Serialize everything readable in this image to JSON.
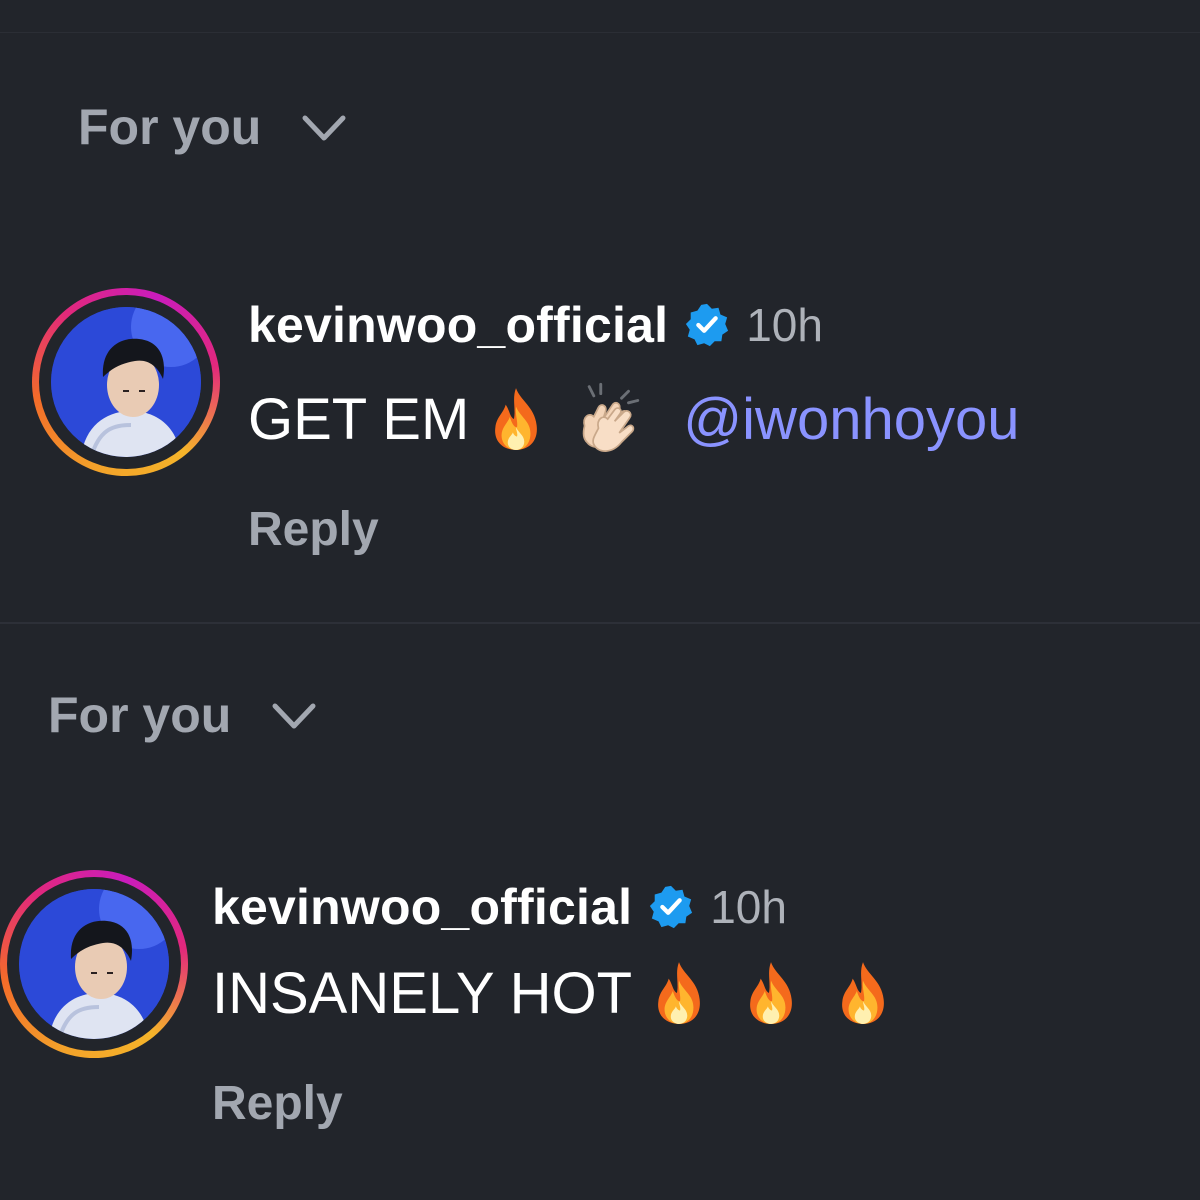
{
  "filters": [
    {
      "label": "For you"
    },
    {
      "label": "For you"
    }
  ],
  "comments": [
    {
      "username": "kevinwoo_official",
      "verified_icon": "verified-badge-icon",
      "time": "10h",
      "text": "GET EM",
      "emojis": [
        "fire",
        "clapping-hands"
      ],
      "mention": "@iwonhoyou",
      "reply_label": "Reply"
    },
    {
      "username": "kevinwoo_official",
      "verified_icon": "verified-badge-icon",
      "time": "10h",
      "text": "INSANELY HOT",
      "emojis": [
        "fire",
        "fire",
        "fire"
      ],
      "reply_label": "Reply"
    }
  ],
  "colors": {
    "background": "#22252b",
    "muted_text": "#a2a7b0",
    "mention": "#8a93ff",
    "verified": "#1d9bf0"
  }
}
